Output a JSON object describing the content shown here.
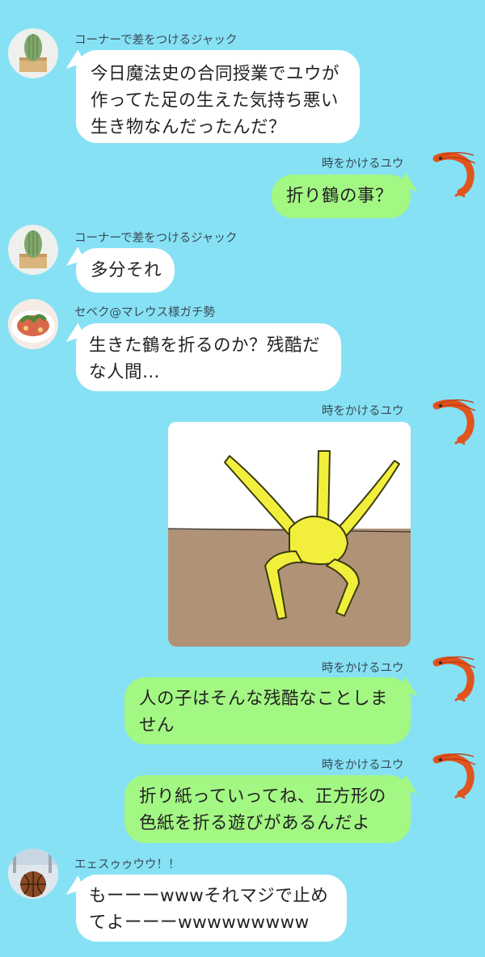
{
  "chat": {
    "messages": [
      {
        "sender": "コーナーで差をつけるジャック",
        "side": "left",
        "lines": [
          "今日魔法史の合同授業でユウが",
          "作ってた足の生えた気持ち悪い",
          "生き物なんだったんだ？"
        ],
        "avatar": "cactus-avatar"
      },
      {
        "sender": "時をかけるユウ",
        "side": "right",
        "lines": [
          "折り鶴の事？"
        ],
        "avatar": "shrimp-avatar"
      },
      {
        "sender": "コーナーで差をつけるジャック",
        "side": "left",
        "lines": [
          "多分それ"
        ],
        "avatar": "cactus-avatar"
      },
      {
        "sender": "セベク@マレウス様ガチ勢",
        "side": "left",
        "lines": [
          "生きた鶴を折るのか？残酷だ",
          "な人間…"
        ],
        "avatar": "salad-avatar"
      },
      {
        "sender": "時をかけるユウ",
        "side": "right",
        "type": "sticker",
        "sticker": "yellow-crane-creature-drawing",
        "avatar": "shrimp-avatar"
      },
      {
        "sender": "時をかけるユウ",
        "side": "right",
        "lines": [
          "人の子はそんな残酷なことしま",
          "せん"
        ],
        "avatar": "shrimp-avatar"
      },
      {
        "sender": "時をかけるユウ",
        "side": "right",
        "lines": [
          "折り紙っていってね、正方形の",
          "色紙を折る遊びがあるんだよ"
        ],
        "avatar": "shrimp-avatar"
      },
      {
        "sender": "エェスゥゥウウ！！",
        "side": "left",
        "lines": [
          "もーーーwwwそれマジで止め",
          "てよーーーwwwwwwwww"
        ],
        "avatar": "basketball-avatar"
      }
    ]
  },
  "colors": {
    "background": "#86e1f5",
    "left_bubble": "#ffffff",
    "right_bubble": "#a3f783"
  }
}
